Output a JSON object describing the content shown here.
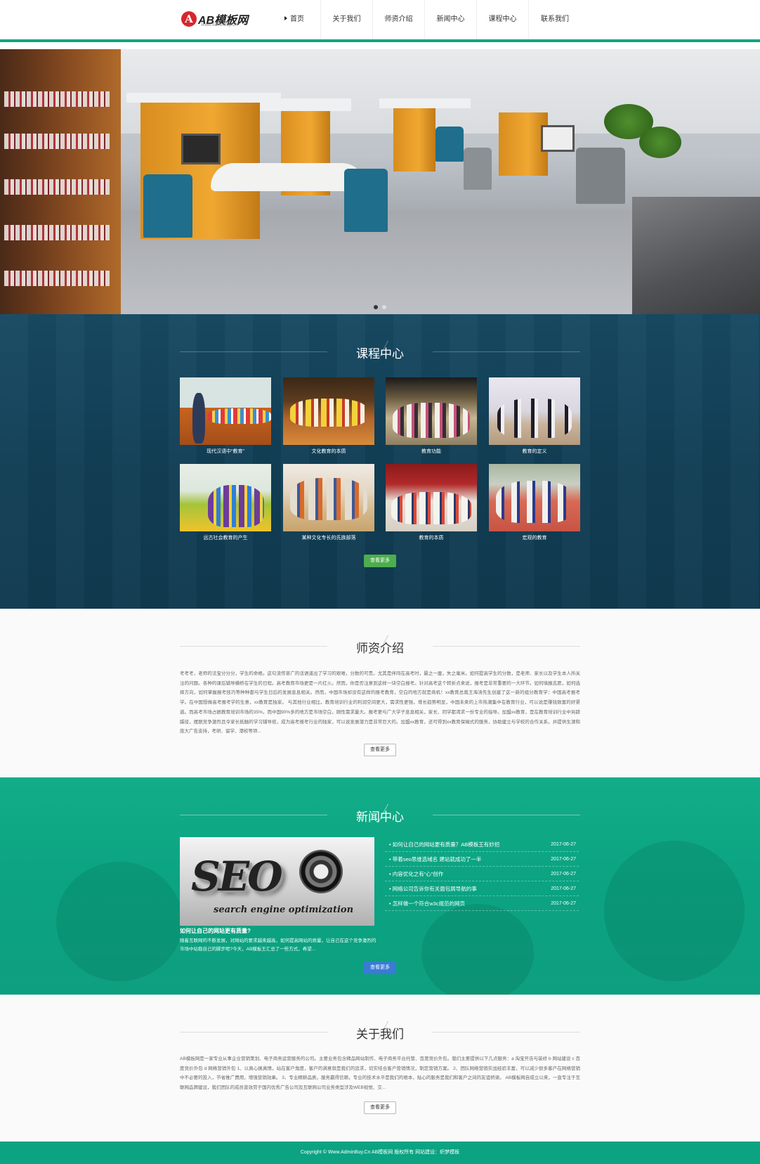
{
  "header": {
    "logo_text": "AB模板网",
    "logo_sub": "Www.AdminBuy.Cn",
    "nav": [
      "首页",
      "关于我们",
      "师资介绍",
      "新闻中心",
      "课程中心",
      "联系我们"
    ]
  },
  "courses": {
    "title": "课程中心",
    "items": [
      {
        "caption": "现代汉语中“教育”"
      },
      {
        "caption": "文化教育的本质"
      },
      {
        "caption": "教育功能"
      },
      {
        "caption": "教育的定义"
      },
      {
        "caption": "远古社会教育的产生"
      },
      {
        "caption": "某种文化专长的氏族部落"
      },
      {
        "caption": "教育的本质"
      },
      {
        "caption": "宏观的教育"
      }
    ],
    "more": "查看更多"
  },
  "teachers": {
    "title": "师资介绍",
    "text": "考考考，老师的法宝分分分，学生的命根。这句流传甚广的话语道出了学习的艰难，分数的可贵。尤其是伴同在高考时，最之一厘，失之毫米。如何提高学生的分数，是老师、家长以及学生本人所关注的问题。各种的课后辅导横桥在学生的日程。高考教育市场更是一片红火。然而，你是否注意到这样一块空白报考。针对高考这个转折点来说，报考是非常重要的一大环节。如何填报志愿，如何选择方向，如何掌握报考技巧等种种都与学生日后的发展息息相关。然而，中国市场却没有这样的报考教育，空白的地方就是商机！xx教育总裁王海涛先生创建了这一新的组分教育学：中国高考报考学。在中国想做高考报考学的生意，xx教育是独家。 与其他行业相比，教育培训行业的利润空间更大，需求性更强，增长趋势明显，中国未来的上市热潮集中在教育行业，可以说是赚钱致富的好渠道。而高考市场占据教育培训市场的35%，而中国90%多的地方是市场空白，刚性需求量大。报考更与广大学子息息相关，家长、同学都渴求一份专业的指导。加盟xx教育，是在教育培训行业中另辟蹊径，摆脱竞争激烈且令家长抵触的学习辅导班，成为高考报考行业的独家，可以说发展潜力是非常巨大的。加盟xx教育，还可得到xx教育保姆式的服务，协助建立与学校的合作关系，并提供生源和庞大广告支持，考研、留学、港校等项...",
    "more": "查看更多"
  },
  "news": {
    "title": "新闻中心",
    "image_label_main": "SEO",
    "image_label_sub": "search engine optimization",
    "featured_title": "如何让自己的网站更有质量?",
    "featured_summary": "随着互联网的不断发展，对网站的要求越来越高，如何提高网站的质量，让自己在这个竞争激烈的市场中站稳自己的脚步呢?今天，AB模板王汇总了一些方式，希望...",
    "list": [
      {
        "title": "如何让自己的网站更有质量？AB模板王有妙招",
        "date": "2017-06-27"
      },
      {
        "title": "带着seo思维选域名 建站就成功了一半",
        "date": "2017-06-27"
      },
      {
        "title": "内容优化之有“心”创作",
        "date": "2017-06-27"
      },
      {
        "title": "网络公司告诉你有关面包屑导航的事",
        "date": "2017-06-27"
      },
      {
        "title": "怎样做一个符合w3c规范的网页",
        "date": "2017-06-27"
      }
    ],
    "more": "查看更多"
  },
  "about": {
    "title": "关于我们",
    "text": "AB模板网是一家专业从事企业营销策划、电子商务运营服务的公司。主要业务包含精品网站制作、电子商务平台托管、百度竞价外包。我们主要提供以下几点服务：a 淘宝开店与装修 b 网站建设 c 百度竞价外包 d 网络营销外包 1、以真心换真情，站在客户角度，客户的满意就是我们的追求，切实结合客户营销情况，制定营销方案。 2、团队网络营销实战经验丰富，可以减少很多客户在网络营销中不必要的投入，节省推广费用，增强营销效果。 3、专业精耕品质，服务赢得信赖，专业的技术水平是我们的根本，贴心的服务是我们和客户之间的友谊桥梁。 AB模板网自成立以来，一直专注于互联网品牌建设，我们团队的成员曾效劳于国内优秀广告公司及互联网公司业务类型涉及WEB视觉、交...",
    "more": "查看更多"
  },
  "footer": {
    "text": "Copyright © Www.AdminBuy.Cn AB模板网 版权所有  网站建设：织梦模板"
  },
  "colors": {
    "brand_green": "#0ba382",
    "courses_bg": "#133f56",
    "button_green": "#4cae4c",
    "button_blue": "#3a7bd5"
  },
  "icons": [
    "logo-icon",
    "nav-arrow-icon",
    "banner-dot-icon"
  ]
}
